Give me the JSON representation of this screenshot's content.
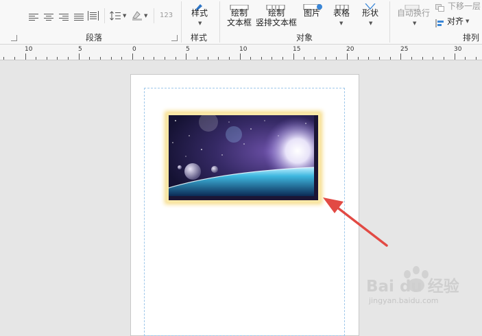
{
  "ribbon": {
    "paragraph": {
      "label": "段落",
      "numbering_text": "123"
    },
    "style": {
      "label": "样式",
      "button_label": "样式"
    },
    "objects": {
      "label": "对象",
      "draw_textbox": [
        "绘制",
        "文本框"
      ],
      "draw_vertical_textbox": [
        "绘制",
        "竖排文本框"
      ],
      "picture": "图片",
      "table": "表格",
      "shape": "形状"
    },
    "arrange": {
      "label": "排列",
      "auto_wrap": "自动换行",
      "send_backward": "下移一层",
      "align": "对齐"
    }
  },
  "ruler": {
    "labels": [
      "10",
      "5",
      "0",
      "5",
      "10",
      "15",
      "20",
      "25",
      "30"
    ]
  },
  "watermark": {
    "brand": "Bai du 经验",
    "url": "jingyan.baidu.com"
  },
  "colors": {
    "ribbon_bg": "#f8f8f8",
    "canvas_bg": "#e6e6e6",
    "margin_guide": "#9ec7ea",
    "picture_glow": "#f6dc88",
    "arrow": "#e24a44"
  }
}
